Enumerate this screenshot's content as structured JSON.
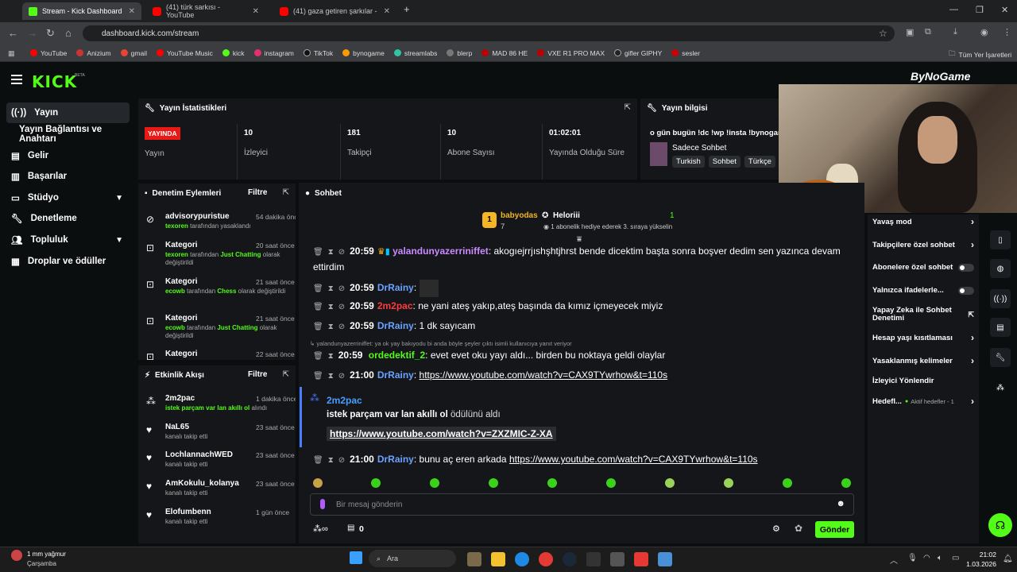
{
  "browser": {
    "tabs": [
      {
        "title": "Stream - Kick Dashboard",
        "icon": "kick-icon",
        "active": true
      },
      {
        "title": "(41) türk sarkısı - YouTube",
        "icon": "youtube-icon",
        "active": false
      },
      {
        "title": "(41) gaza getiren şarkılar - YouTube",
        "icon": "youtube-icon",
        "active": false
      }
    ],
    "url": "dashboard.kick.com/stream",
    "bookmarks": [
      "YouTube",
      "Anizium",
      "gmail",
      "YouTube Music",
      "kick",
      "instagram",
      "TikTok",
      "bynogame",
      "streamlabs",
      "blerp",
      "MAD 86 HE",
      "VXE R1 PRO MAX",
      "gifler GIPHY",
      "sesler"
    ],
    "bookmarks_right": "Tüm Yer İşaretleri"
  },
  "header": {
    "logo": "KICK",
    "beta": "BETA",
    "brand": "ByNoGame"
  },
  "sidebar": {
    "items": [
      {
        "label": "Yayın",
        "icon": "broadcast-icon",
        "active": true
      },
      {
        "label": "Yayın Bağlantısı ve Anahtarı"
      },
      {
        "label": "Gelir",
        "icon": "wallet-icon"
      },
      {
        "label": "Başarılar",
        "icon": "trophy-icon"
      },
      {
        "label": "Stüdyo",
        "icon": "studio-icon",
        "chevron": true
      },
      {
        "label": "Denetleme",
        "icon": "wrench-icon"
      },
      {
        "label": "Topluluk",
        "icon": "community-icon",
        "chevron": true
      },
      {
        "label": "Droplar ve ödüller",
        "icon": "gift-icon"
      }
    ]
  },
  "stats": {
    "title": "Yayın İstatistikleri",
    "live_badge": "YAYINDA",
    "live_label": "Yayın",
    "items": [
      {
        "value": "10",
        "label": "İzleyici"
      },
      {
        "value": "181",
        "label": "Takipçi"
      },
      {
        "value": "10",
        "label": "Abone Sayısı"
      },
      {
        "value": "01:02:01",
        "label": "Yayında Olduğu Süre"
      }
    ]
  },
  "info": {
    "title": "Yayın bilgisi",
    "stream_title": "o gün bugün !dc !wp !insta !bynogam",
    "category": "Sadece Sohbet",
    "tags": [
      "Turkish",
      "Sohbet",
      "Türkçe"
    ]
  },
  "moderation": {
    "title": "Denetim Eylemleri",
    "filter": "Filtre",
    "items": [
      {
        "name": "advisorypuristue",
        "time": "54 dakika önce",
        "user": "texoren",
        "desc": "tarafından yasaklandı",
        "extra": ""
      },
      {
        "name": "Kategori",
        "time": "20 saat önce",
        "user": "texoren",
        "desc": "tarafından",
        "cat": "Just Chatting",
        "extra": "olarak değiştirildi"
      },
      {
        "name": "Kategori",
        "time": "21 saat önce",
        "user": "ecowb",
        "desc": "tarafından",
        "cat": "Chess",
        "extra": "olarak değiştirildi"
      },
      {
        "name": "Kategori",
        "time": "21 saat önce",
        "user": "ecowb",
        "desc": "tarafından",
        "cat": "Just Chatting",
        "extra": "olarak değiştirildi"
      },
      {
        "name": "Kategori",
        "time": "22 saat önce",
        "user": "",
        "desc": "",
        "cat": "",
        "extra": ""
      }
    ]
  },
  "activity": {
    "title": "Etkinlik Akışı",
    "filter": "Filtre",
    "items": [
      {
        "name": "2m2pac",
        "time": "1 dakika önce",
        "line": "istek parçam var lan akıllı ol",
        "suffix": "alındı"
      },
      {
        "name": "NaL65",
        "time": "23 saat önce",
        "desc": "kanalı takip etti"
      },
      {
        "name": "LochlannachWED",
        "time": "23 saat önce",
        "desc": "kanalı takip etti"
      },
      {
        "name": "AmKokulu_kolanya",
        "time": "23 saat önce",
        "desc": "kanalı takip etti"
      },
      {
        "name": "Elofumbenn",
        "time": "1 gün önce",
        "desc": "kanalı takip etti"
      }
    ]
  },
  "chat": {
    "title": "Sohbet",
    "leader": {
      "name": "babyodas",
      "count": "7",
      "rank": "1"
    },
    "gifter": {
      "name": "Heloriii",
      "note": "1 abonelik hediye ederek 3. sıraya yükselin",
      "count": "1"
    },
    "messages": [
      {
        "time": "20:59",
        "user": "yalandunyazerriniffet",
        "color": "#c98bff",
        "text": "akogıejrrjıshşhtjhrst bende dicektim başta sonra boşver dedim sen yazınca devam ettirdim"
      },
      {
        "time": "20:59",
        "user": "DrRainy",
        "color": "#6aa3ff",
        "text": ""
      },
      {
        "time": "20:59",
        "user": "2m2pac",
        "color": "#ff3b3b",
        "text": "ne yani ateş yakıp,ateş başında da kımız içmeyecek miyiz"
      },
      {
        "time": "20:59",
        "user": "DrRainy",
        "color": "#6aa3ff",
        "text": "1 dk sayıcam"
      },
      {
        "time": "20:59",
        "user": "ordedektif_2",
        "color": "#53fc18",
        "text": "evet evet oku yayı aldı... birden bu noktaya geldi olaylar"
      },
      {
        "time": "21:00",
        "user": "DrRainy",
        "color": "#6aa3ff",
        "link": "https://www.youtube.com/watch?v=CAX9TYwrhow&t=110s"
      },
      {
        "time": "21:00",
        "user": "DrRainy",
        "color": "#6aa3ff",
        "text": "bunu aç eren arkada",
        "link": "https://www.youtube.com/watch?v=CAX9TYwrhow&t=110s"
      }
    ],
    "reply_hint": "yalandunyazerriniffet: ya ok yay bakıyodu bi anda böyle şeyler çıktı isimli kullanıcıya yanıt veriyor",
    "redeem": {
      "user": "2m2pac",
      "reward": "istek parçam var lan akıllı ol",
      "suffix": "ödülünü aldı",
      "link": "https://www.youtube.com/watch?v=ZXZMIC-Z-XA"
    },
    "placeholder": "Bir mesaj gönderin",
    "points": "0",
    "send": "Gönder"
  },
  "settings": {
    "items": [
      {
        "label": "Yavaş mod",
        "type": "arrow"
      },
      {
        "label": "Takipçilere özel sohbet",
        "type": "arrow"
      },
      {
        "label": "Abonelere özel sohbet",
        "type": "toggle"
      },
      {
        "label": "Yalnızca ifadelerle...",
        "type": "toggle"
      },
      {
        "label": "Yapay Zeka ile Sohbet Denetimi",
        "type": "ext"
      },
      {
        "label": "Hesap yaşı kısıtlaması",
        "type": "arrow"
      },
      {
        "label": "Yasaklanmış kelimeler",
        "type": "arrow"
      },
      {
        "label": "İzleyici Yönlendir",
        "type": "none"
      },
      {
        "label": "Hedefl...",
        "type": "arrow",
        "note": "Aktif hedefler - 1"
      }
    ]
  },
  "taskbar": {
    "weather": "1 mm yağmur",
    "day": "Çarşamba",
    "search": "Ara",
    "time": "21:02",
    "date": "1.03.2026"
  }
}
